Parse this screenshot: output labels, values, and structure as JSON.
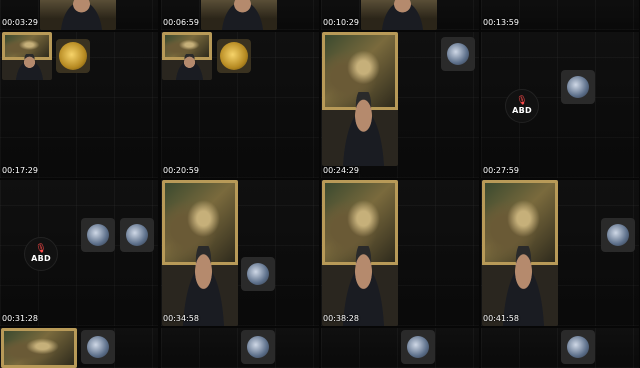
{
  "tiles": [
    {
      "timestamp": "00:03:29"
    },
    {
      "timestamp": "00:06:59"
    },
    {
      "timestamp": "00:10:29"
    },
    {
      "timestamp": "00:13:59"
    },
    {
      "timestamp": "00:17:29"
    },
    {
      "timestamp": "00:20:59"
    },
    {
      "timestamp": "00:24:29"
    },
    {
      "timestamp": "00:27:59"
    },
    {
      "timestamp": "00:31:28"
    },
    {
      "timestamp": "00:34:58"
    },
    {
      "timestamp": "00:38:28"
    },
    {
      "timestamp": "00:41:58"
    }
  ],
  "host_badge": {
    "label": "ABD",
    "icon": "microphone-icon",
    "icon_color": "#ff4a4a"
  },
  "theme": {
    "background": "#070707",
    "timestamp_color": "#ffffff"
  }
}
